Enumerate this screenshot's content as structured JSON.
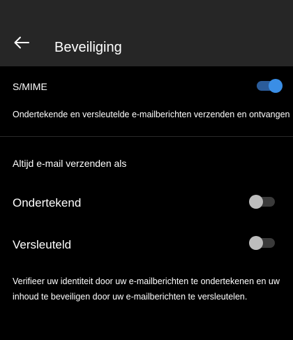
{
  "header": {
    "title": "Beveiliging",
    "back_icon": "arrow-left-icon"
  },
  "smime": {
    "label": "S/MIME",
    "enabled": true,
    "description": "Ondertekende en versleutelde e-mailberichten verzenden en ontvangen"
  },
  "send_as": {
    "label": "Altijd e-mail verzenden als"
  },
  "options": {
    "signed": {
      "label": "Ondertekend",
      "enabled": false
    },
    "encrypted": {
      "label": "Versleuteld",
      "enabled": false
    }
  },
  "footer": {
    "text": "Verifieer uw identiteit door uw e-mailberichten te ondertekenen en uw inhoud te beveiligen door uw e-mailberichten te versleutelen."
  },
  "colors": {
    "header_bg": "#262626",
    "background": "#000000",
    "toggle_on_track": "#2b5c9a",
    "toggle_on_knob": "#3a8ee6",
    "toggle_off_track": "#3a3a3a",
    "toggle_off_knob": "#bdbdbd"
  }
}
